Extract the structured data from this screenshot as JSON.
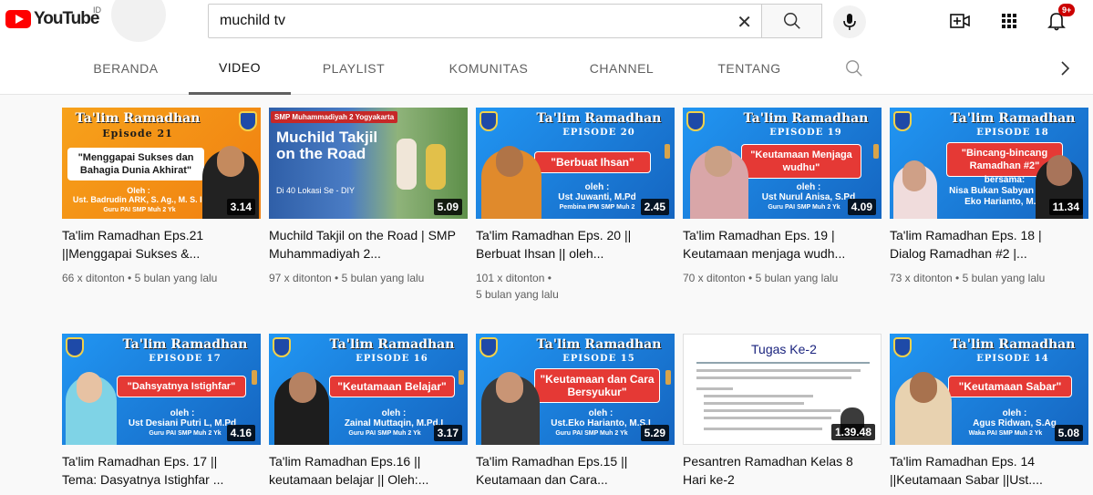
{
  "masthead": {
    "logo_text": "YouTube",
    "country_code": "ID",
    "search_value": "muchild tv",
    "notification_count": "9+"
  },
  "tabs": [
    {
      "label": "BERANDA"
    },
    {
      "label": "VIDEO"
    },
    {
      "label": "PLAYLIST"
    },
    {
      "label": "KOMUNITAS"
    },
    {
      "label": "CHANNEL"
    },
    {
      "label": "TENTANG"
    }
  ],
  "active_tab": "VIDEO",
  "videos": [
    {
      "title": "Ta'lim Ramadhan Eps.21 ||Menggapai Sukses &...",
      "views": "66 x ditonton",
      "age": "5 bulan yang lalu",
      "duration": "3.14",
      "thumb": {
        "heading": "Ta'lim Ramadhan",
        "episode": "Episode 21",
        "topic": "\"Menggapai Sukses dan Bahagia Dunia Akhirat\"",
        "oleh": "Oleh :",
        "speaker": "Ust. Badrudin ARK, S. Ag., M. S. I.",
        "role": "Guru PAI SMP Muh 2 Yk"
      }
    },
    {
      "title": "Muchild Takjil on the Road | SMP Muhammadiyah 2...",
      "views": "97 x ditonton",
      "age": "5 bulan yang lalu",
      "duration": "5.09",
      "thumb": {
        "banner": "SMP Muhammadiyah 2 Yogyakarta",
        "heading": "Muchild Takjil on the Road",
        "sub": "Di 40 Lokasi Se - DIY"
      }
    },
    {
      "title": "Ta'lim Ramadhan Eps. 20 || Berbuat Ihsan || oleh...",
      "views": "101 x ditonton",
      "age": "5 bulan yang lalu",
      "duration": "2.45",
      "thumb": {
        "heading": "Ta'lim Ramadhan",
        "episode": "EPISODE 20",
        "topic": "\"Berbuat Ihsan\"",
        "oleh": "oleh :",
        "speaker": "Ust Juwanti, M.Pd",
        "role": "Pembina IPM SMP Muh 2"
      }
    },
    {
      "title": "Ta'lim Ramadhan Eps. 19 | Keutamaan menjaga wudh...",
      "views": "70 x ditonton",
      "age": "5 bulan yang lalu",
      "duration": "4.09",
      "thumb": {
        "heading": "Ta'lim Ramadhan",
        "episode": "EPISODE 19",
        "topic": "\"Keutamaan Menjaga wudhu\"",
        "oleh": "oleh :",
        "speaker": "Ust Nurul Anisa, S.Pd",
        "role": "Guru PAI SMP Muh 2 Yk"
      }
    },
    {
      "title": "Ta'lim Ramadhan Eps. 18 | Dialog Ramadhan #2 |...",
      "views": "73 x ditonton",
      "age": "5 bulan yang lalu",
      "duration": "11.34",
      "thumb": {
        "heading": "Ta'lim Ramadhan",
        "episode": "EPISODE 18",
        "topic": "\"Bincang-bincang Ramadhan #2\"",
        "oleh": "bersama:",
        "speaker": "Nisa Bukan Sabyan & Ust Eko Harianto, M.SI",
        "role": ""
      }
    },
    {
      "title": "Ta'lim Ramadhan Eps. 17 || Tema: Dasyatnya Istighfar ...",
      "views": "",
      "age": "",
      "duration": "4.16",
      "thumb": {
        "heading": "Ta'lim Ramadhan",
        "episode": "EPISODE 17",
        "topic": "\"Dahsyatnya Istighfar\"",
        "oleh": "oleh :",
        "speaker": "Ust Desiani Putri L, M.Pd",
        "role": "Guru PAI SMP Muh 2 Yk"
      }
    },
    {
      "title": "Ta'lim Ramadhan Eps.16 || keutamaan belajar || Oleh:...",
      "views": "",
      "age": "",
      "duration": "3.17",
      "thumb": {
        "heading": "Ta'lim Ramadhan",
        "episode": "EPISODE 16",
        "topic": "\"Keutamaan Belajar\"",
        "oleh": "oleh :",
        "speaker": "Zainal Muttaqin, M.Pd.I",
        "role": "Guru PAI SMP Muh 2 Yk"
      }
    },
    {
      "title": "Ta'lim Ramadhan Eps.15 || Keutamaan dan Cara...",
      "views": "",
      "age": "",
      "duration": "5.29",
      "thumb": {
        "heading": "Ta'lim Ramadhan",
        "episode": "EPISODE 15",
        "topic": "\"Keutamaan dan Cara Bersyukur\"",
        "oleh": "oleh :",
        "speaker": "Ust.Eko Harianto, M.S.I",
        "role": "Guru PAI SMP Muh 2 Yk"
      }
    },
    {
      "title": "Pesantren Ramadhan Kelas 8 Hari ke-2",
      "views": "",
      "age": "",
      "duration": "1.39.48",
      "thumb": {
        "heading": "Tugas Ke-2",
        "episode": "",
        "topic": "",
        "oleh": "",
        "speaker": "",
        "role": ""
      }
    },
    {
      "title": "Ta'lim Ramadhan Eps. 14 ||Keutamaan Sabar ||Ust....",
      "views": "",
      "age": "",
      "duration": "5.08",
      "thumb": {
        "heading": "Ta'lim Ramadhan",
        "episode": "EPISODE 14",
        "topic": "\"Keutamaan Sabar\"",
        "oleh": "oleh :",
        "speaker": "Agus Ridwan, S.Ag",
        "role": "Waka PAI SMP Muh 2 Yk"
      }
    }
  ],
  "colors": {
    "youtube_red": "#ff0000",
    "thumb_blue": "#1e88e5",
    "thumb_orange": "#f59c1a",
    "topic_red": "#e53935"
  }
}
